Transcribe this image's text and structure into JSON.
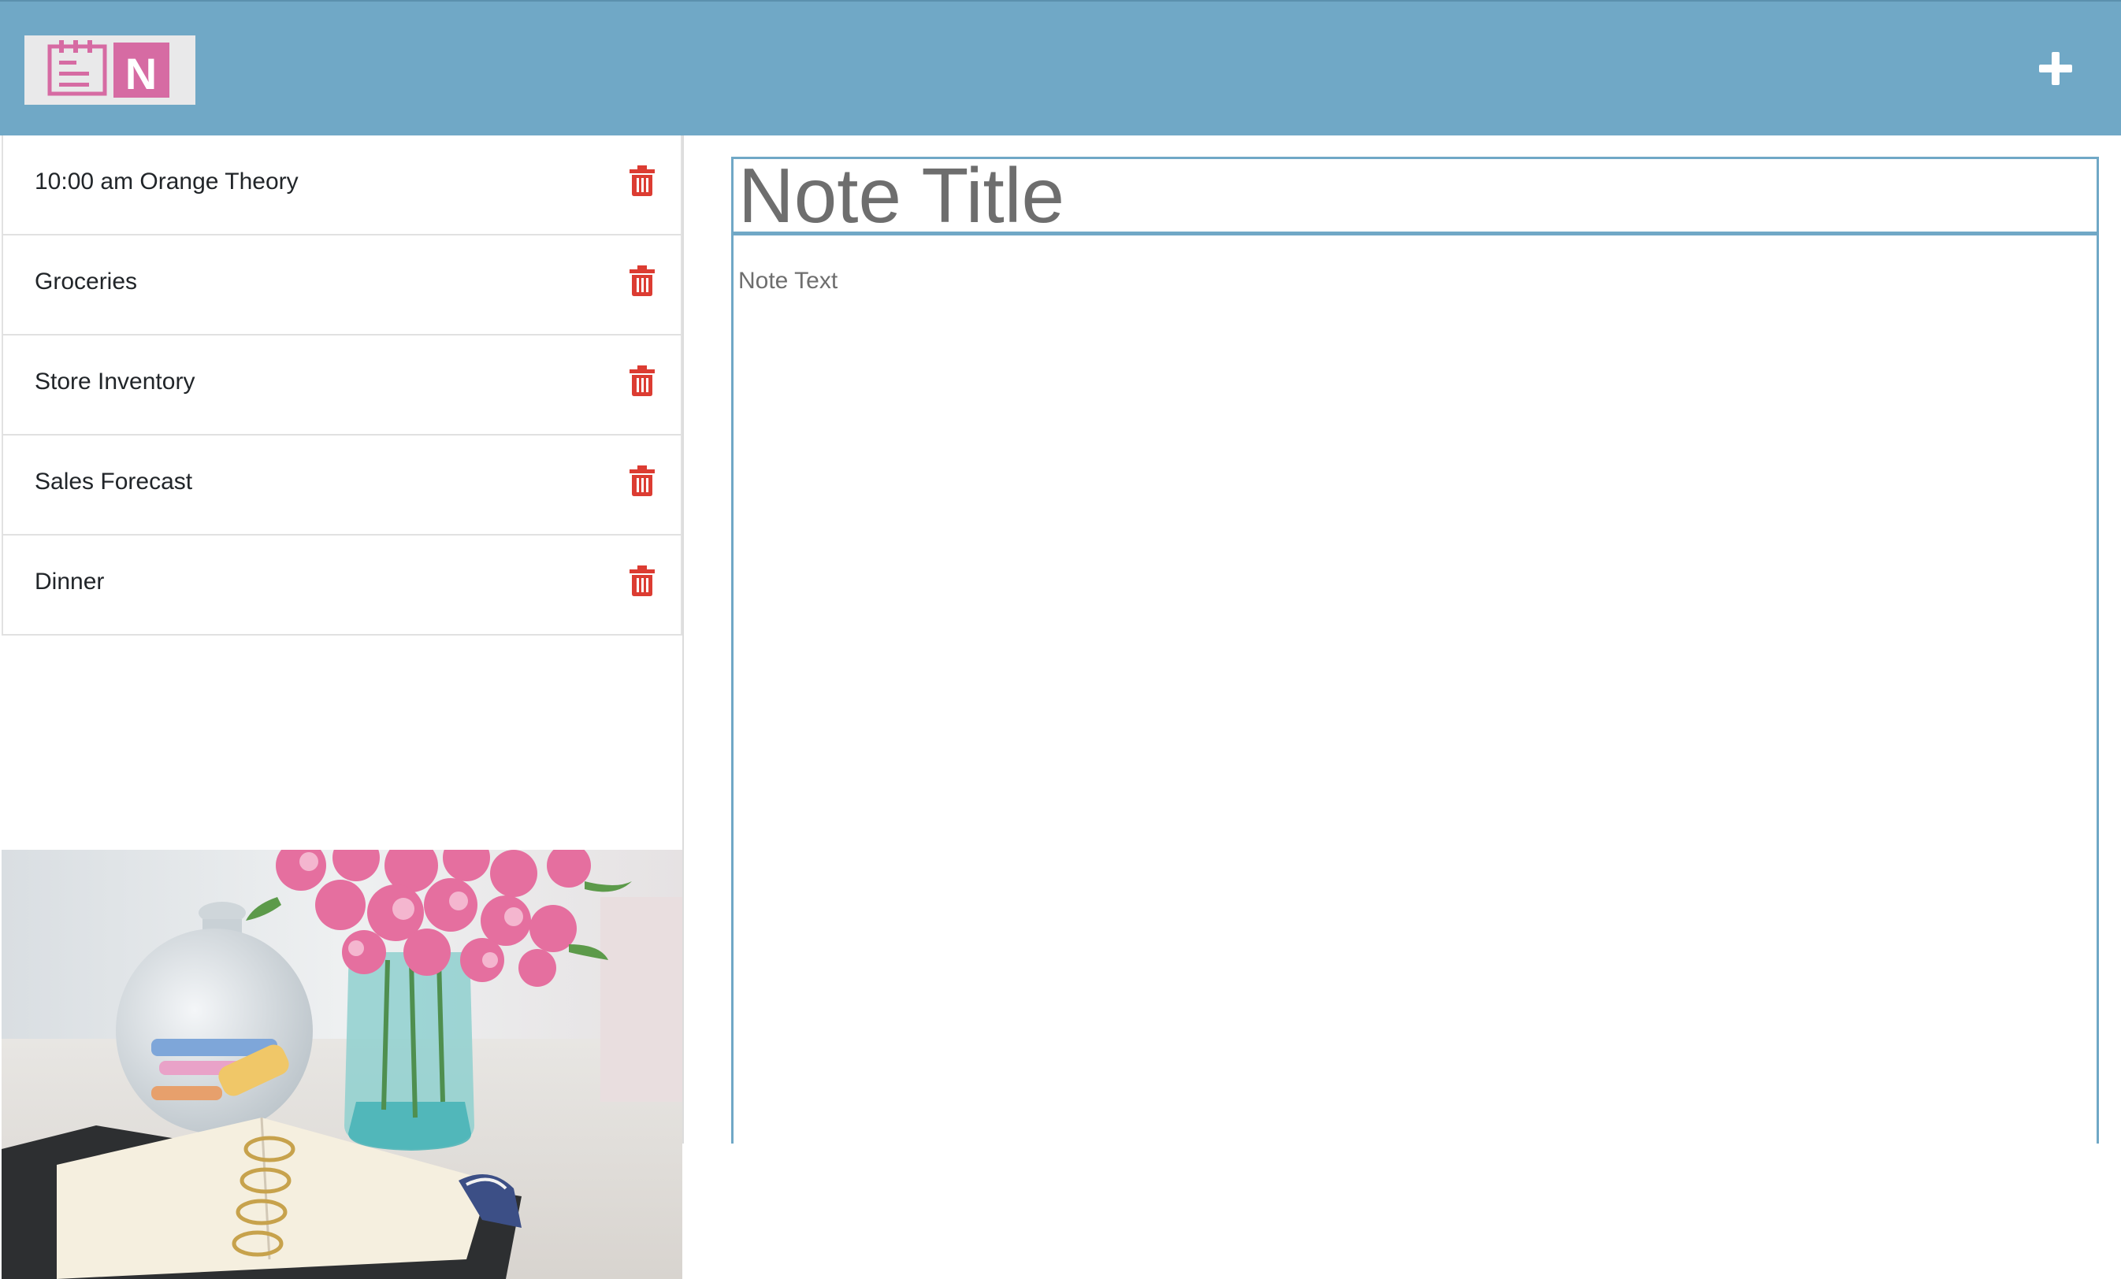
{
  "header": {
    "logo_letter": "N",
    "add_icon": "plus-icon",
    "colors": {
      "bar": "#70a8c6",
      "logo_pink": "#d66ba3",
      "logo_bg": "#e9e9ea"
    }
  },
  "notes": [
    {
      "title": "10:00 am Orange Theory",
      "delete_icon": "trash-icon"
    },
    {
      "title": "Groceries",
      "delete_icon": "trash-icon"
    },
    {
      "title": "Store Inventory",
      "delete_icon": "trash-icon"
    },
    {
      "title": "Sales Forecast",
      "delete_icon": "trash-icon"
    },
    {
      "title": "Dinner",
      "delete_icon": "trash-icon"
    }
  ],
  "editor": {
    "title_placeholder": "Note Title",
    "text_placeholder": "Note Text",
    "accent": "#70a8c6"
  },
  "colors": {
    "trash": "#dc3c32",
    "text": "#212529"
  }
}
